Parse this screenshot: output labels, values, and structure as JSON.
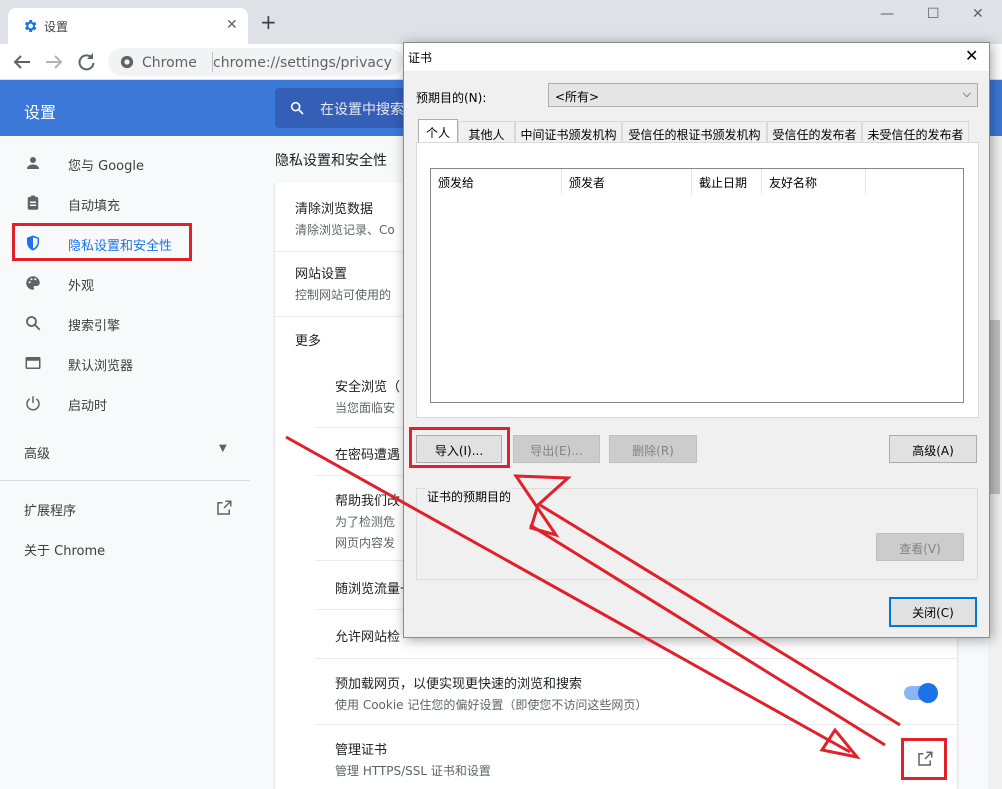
{
  "browser": {
    "tab_title": "设置",
    "address_scheme": "Chrome",
    "address_url": "chrome://settings/privacy"
  },
  "header": {
    "title": "设置",
    "search_placeholder": "在设置中搜索"
  },
  "sidebar": {
    "items": [
      {
        "label": "您与 Google",
        "icon": "person-icon"
      },
      {
        "label": "自动填充",
        "icon": "clipboard-icon"
      },
      {
        "label": "隐私设置和安全性",
        "icon": "shield-icon",
        "active": true
      },
      {
        "label": "外观",
        "icon": "palette-icon"
      },
      {
        "label": "搜索引擎",
        "icon": "search-icon"
      },
      {
        "label": "默认浏览器",
        "icon": "browser-icon"
      },
      {
        "label": "启动时",
        "icon": "power-icon"
      }
    ],
    "advanced_label": "高级",
    "extensions_label": "扩展程序",
    "about_label": "关于 Chrome"
  },
  "main": {
    "section_title": "隐私设置和安全性",
    "rows": {
      "clear_title": "清除浏览数据",
      "clear_sub": "清除浏览记录、Co",
      "site_title": "网站设置",
      "site_sub": "控制网站可使用的",
      "more_label": "更多",
      "safe_title": "安全浏览（",
      "safe_sub": "当您面临安",
      "pwd_title": "在密码遭遇",
      "help_title": "帮助我们改",
      "help_sub1": "为了检测危",
      "help_sub2": "网页内容发",
      "traffic_title": "随浏览流量一",
      "allow_title": "允许网站检",
      "preload_title": "预加载网页，以便实现更快速的浏览和搜索",
      "preload_sub": "使用 Cookie 记住您的偏好设置（即使您不访问这些网页）",
      "cert_title": "管理证书",
      "cert_sub": "管理 HTTPS/SSL 证书和设置"
    }
  },
  "dialog": {
    "title": "证书",
    "purpose_label": "预期目的(N):",
    "purpose_value": "<所有>",
    "tabs": [
      "个人",
      "其他人",
      "中间证书颁发机构",
      "受信任的根证书颁发机构",
      "受信任的发布者",
      "未受信任的发布者"
    ],
    "columns": [
      "颁发给",
      "颁发者",
      "截止日期",
      "友好名称"
    ],
    "buttons": {
      "import": "导入(I)...",
      "export": "导出(E)...",
      "remove": "删除(R)",
      "advanced": "高级(A)",
      "view": "查看(V)",
      "close": "关闭(C)"
    },
    "group_label": "证书的预期目的"
  },
  "colors": {
    "accent": "#1a73e8",
    "header_bg": "#3c78d8",
    "annotation": "#e0202a"
  }
}
